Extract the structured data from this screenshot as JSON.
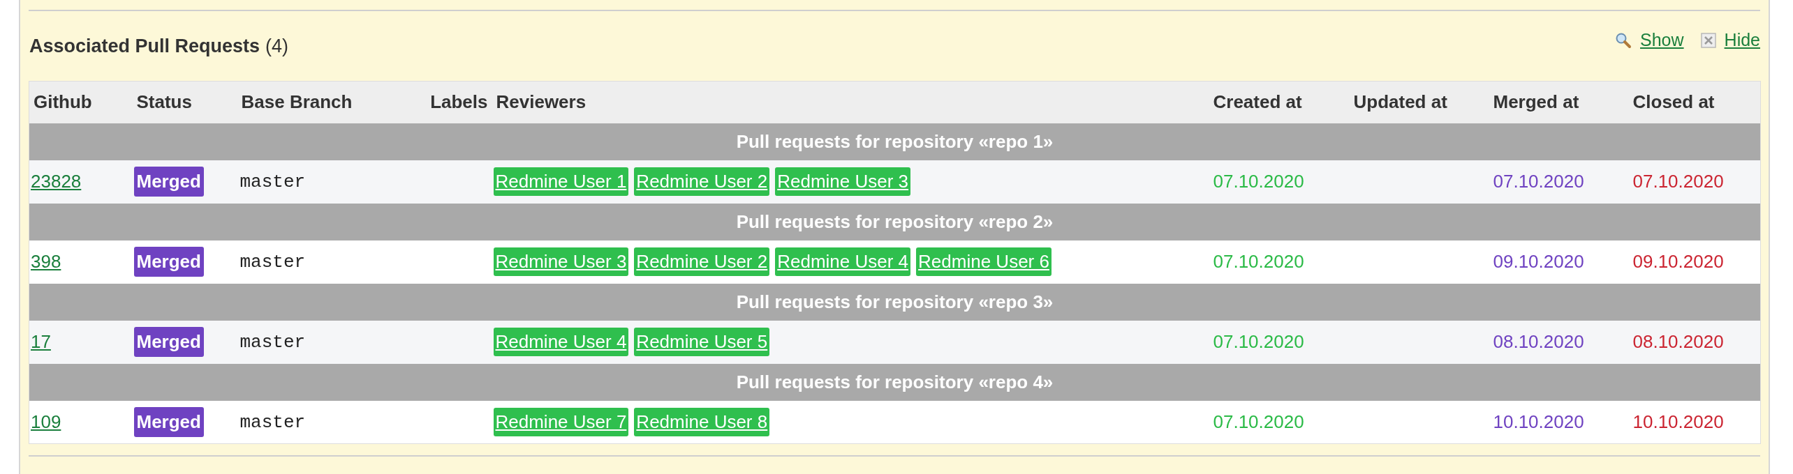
{
  "section": {
    "title": "Associated Pull Requests",
    "count": "(4)",
    "actions": [
      {
        "kind": "show",
        "label": "Show"
      },
      {
        "kind": "hide",
        "label": "Hide"
      }
    ]
  },
  "table": {
    "columns": [
      "Github",
      "Status",
      "Base Branch",
      "Labels",
      "Reviewers",
      "Created at",
      "Updated at",
      "Merged at",
      "Closed at"
    ],
    "groups": [
      {
        "title": "Pull requests for repository «repo 1»",
        "rows": [
          {
            "number": "23828",
            "status": "Merged",
            "base_branch": "master",
            "reviewers": [
              "Redmine User 1",
              "Redmine User 2",
              "Redmine User 3"
            ],
            "created_at": "07.10.2020",
            "merged_at": "07.10.2020",
            "closed_at": "07.10.2020"
          }
        ]
      },
      {
        "title": "Pull requests for repository «repo 2»",
        "rows": [
          {
            "number": "398",
            "status": "Merged",
            "base_branch": "master",
            "reviewers": [
              "Redmine User 3",
              "Redmine User 2",
              "Redmine User 4",
              "Redmine User 6"
            ],
            "created_at": "07.10.2020",
            "merged_at": "09.10.2020",
            "closed_at": "09.10.2020"
          }
        ]
      },
      {
        "title": "Pull requests for repository «repo 3»",
        "rows": [
          {
            "number": "17",
            "status": "Merged",
            "base_branch": "master",
            "reviewers": [
              "Redmine User 4",
              "Redmine User 5"
            ],
            "created_at": "07.10.2020",
            "merged_at": "08.10.2020",
            "closed_at": "08.10.2020"
          }
        ]
      },
      {
        "title": "Pull requests for repository «repo 4»",
        "rows": [
          {
            "number": "109",
            "status": "Merged",
            "base_branch": "master",
            "reviewers": [
              "Redmine User 7",
              "Redmine User 8"
            ],
            "created_at": "07.10.2020",
            "merged_at": "10.10.2020",
            "closed_at": "10.10.2020"
          }
        ]
      }
    ]
  }
}
